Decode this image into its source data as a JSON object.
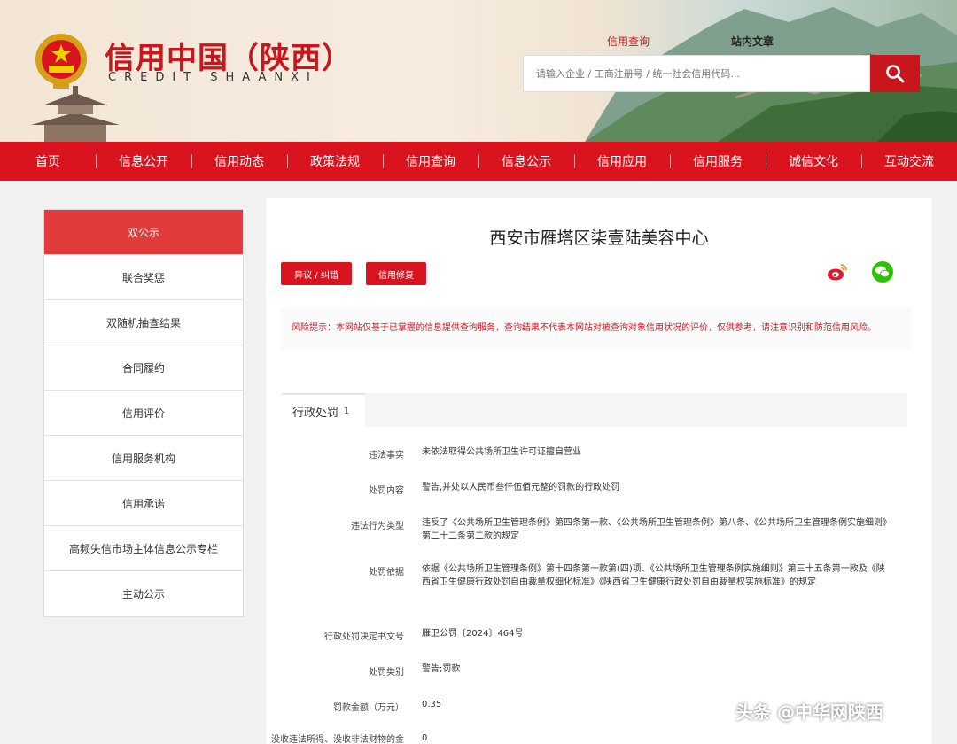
{
  "header": {
    "logo_title": "信用中国（陕西）",
    "logo_subtitle": "CREDIT SHAANXI",
    "top_links": [
      "信用查询",
      "站内文章"
    ],
    "search_placeholder": "请输入企业 / 工商注册号 / 统一社会信用代码..."
  },
  "nav": [
    "首页",
    "信息公开",
    "信用动态",
    "政策法规",
    "信用查询",
    "信息公示",
    "信用应用",
    "信用服务",
    "诚信文化",
    "互动交流"
  ],
  "sidebar": [
    "双公示",
    "联合奖惩",
    "双随机抽查结果",
    "合同履约",
    "信用评价",
    "信用服务机构",
    "信用承诺",
    "高频失信市场主体信息公示专栏",
    "主动公示"
  ],
  "main": {
    "company": "西安市雁塔区柒壹陆美容中心",
    "buttons": [
      "异议 / 纠错",
      "信用修复"
    ],
    "risk_notice": "风险提示：本网站仅基于已掌握的信息提供查询服务，查询结果不代表本网站对被查询对象信用状况的评价，仅供参考，请注意识别和防范信用风险。",
    "section_title": "行政处罚",
    "section_count": "1",
    "records": [
      {
        "label": "违法事实",
        "value": "未依法取得公共场所卫生许可证擅自营业"
      },
      {
        "label": "处罚内容",
        "value": "警告,并处以人民币叁仟伍佰元整的罚款的行政处罚"
      },
      {
        "label": "违法行为类型",
        "value": "违反了《公共场所卫生管理条例》第四条第一款、《公共场所卫生管理条例》第八条、《公共场所卫生管理条例实施细则》第二十二条第二款的规定"
      },
      {
        "label": "处罚依据",
        "value": "依据《公共场所卫生管理条例》第十四条第一款第(四)项、《公共场所卫生管理条例实施细则》第三十五条第一款及《陕西省卫生健康行政处罚自由裁量权细化标准》《陕西省卫生健康行政处罚自由裁量权实施标准》的规定"
      },
      {
        "label": "行政处罚决定书文号",
        "value": "雁卫公罚〔2024〕464号"
      },
      {
        "label": "处罚类别",
        "value": "警告;罚款"
      },
      {
        "label": "罚款金额（万元）",
        "value": "0.35"
      },
      {
        "label": "没收违法所得、没收非法财物的金额（万元）",
        "value": "0"
      }
    ]
  },
  "watermark": "头条 @中华网陕西",
  "colors": {
    "brand_red": "#d9141e",
    "sidebar_active": "#e23b3b"
  }
}
